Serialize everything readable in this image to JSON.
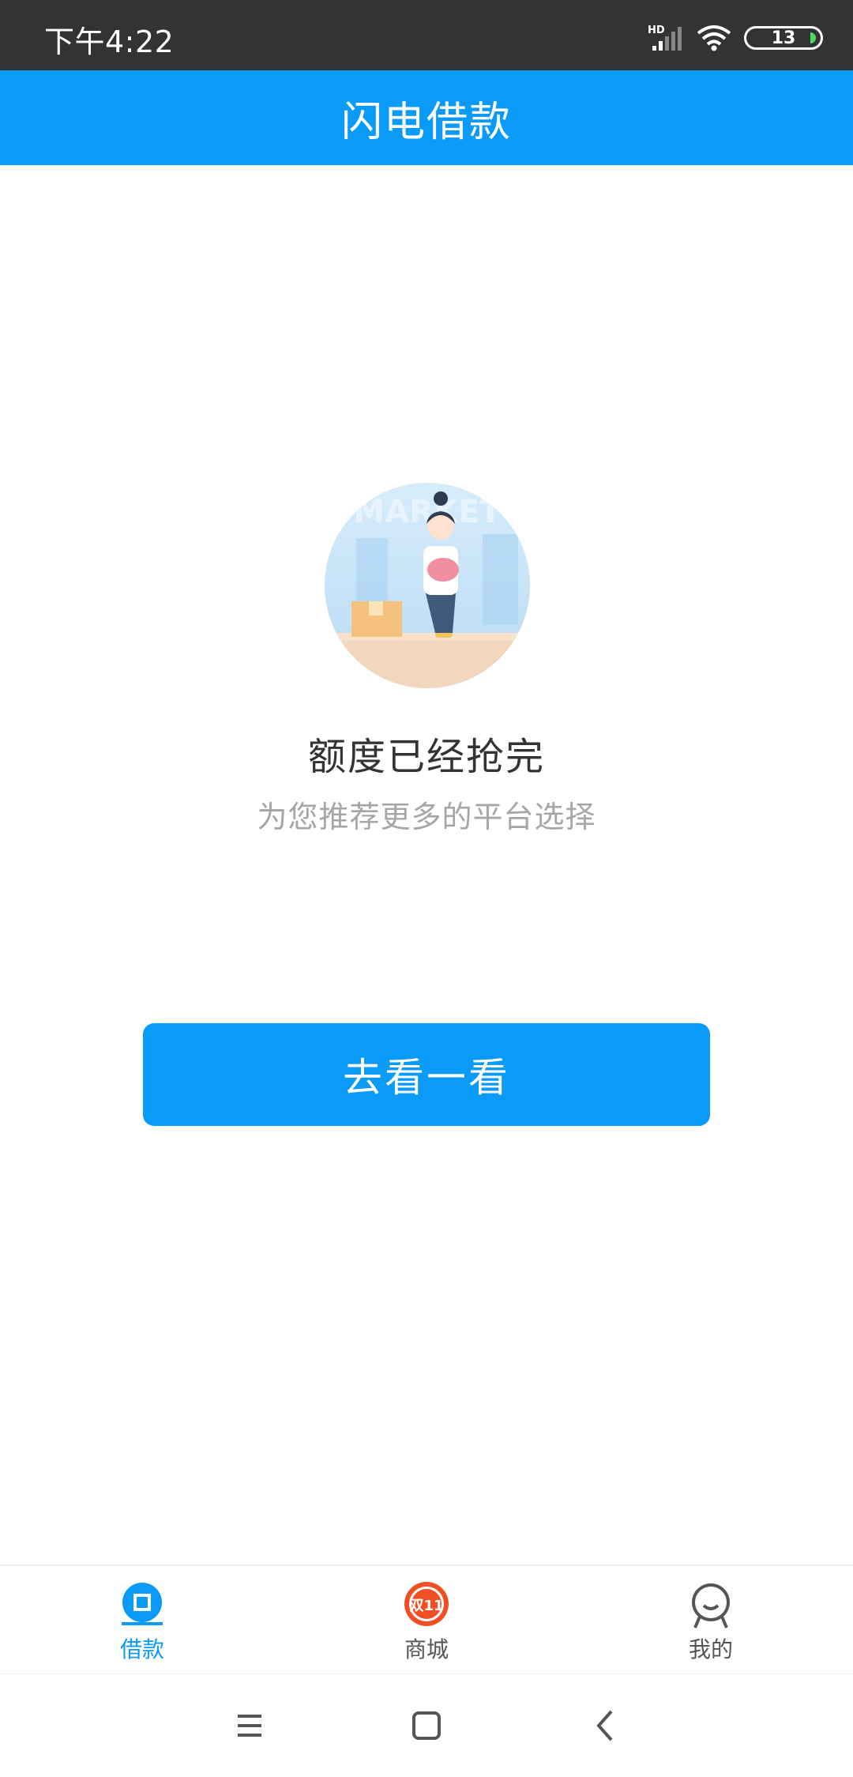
{
  "status_bar": {
    "time": "下午4:22",
    "battery": "13",
    "network_badge": "HD"
  },
  "header": {
    "title": "闪电借款"
  },
  "empty_state": {
    "title": "额度已经抢完",
    "subtitle": "为您推荐更多的平台选择",
    "illustration_text": "MARKET"
  },
  "action": {
    "button_label": "去看一看"
  },
  "tabs": [
    {
      "label": "借款",
      "icon": "loan-icon",
      "active": true
    },
    {
      "label": "商城",
      "icon": "double-eleven-mall-icon",
      "badge": "双11",
      "active": false
    },
    {
      "label": "我的",
      "icon": "profile-icon",
      "active": false
    }
  ],
  "colors": {
    "accent": "#0a9bf9",
    "status_bar": "#333333",
    "mall_badge": "#f04e23"
  }
}
